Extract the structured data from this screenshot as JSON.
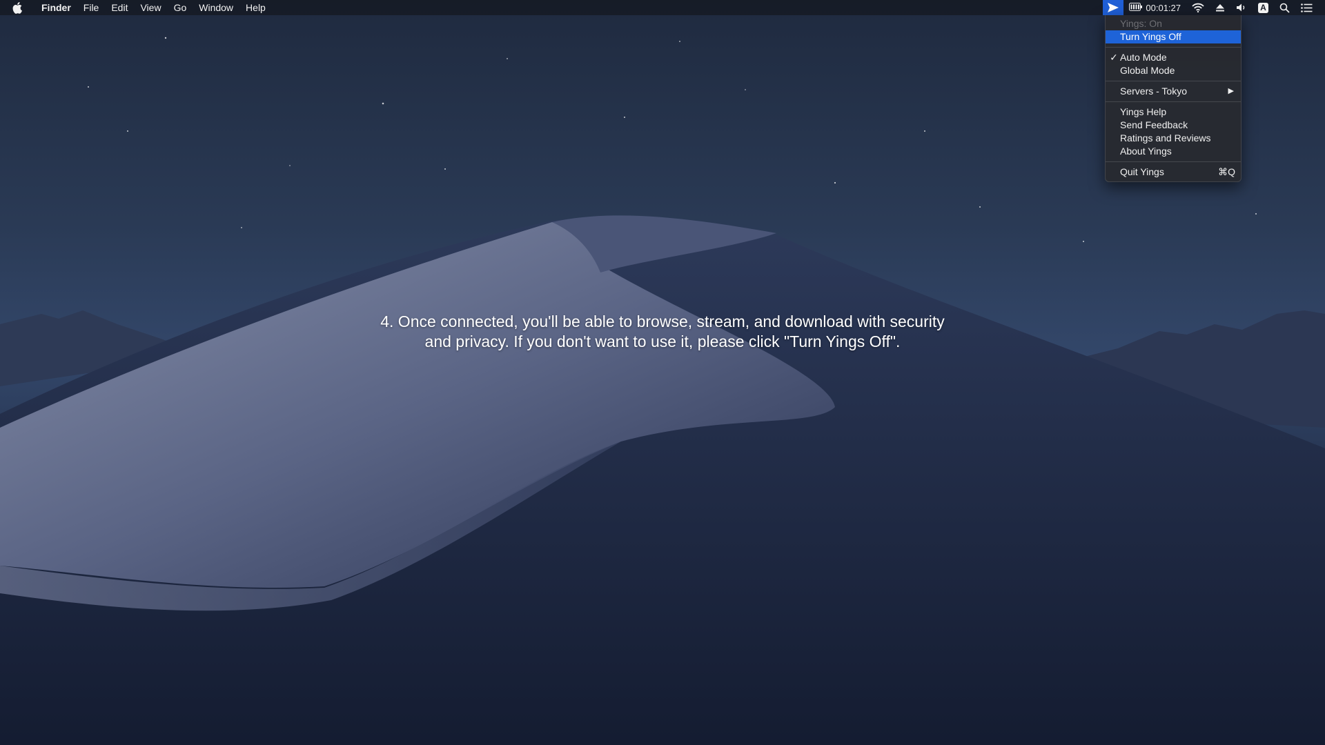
{
  "menubar": {
    "app_name": "Finder",
    "menus": [
      "File",
      "Edit",
      "View",
      "Go",
      "Window",
      "Help"
    ],
    "status": {
      "timer": "00:01:27",
      "input_source": "A"
    }
  },
  "dropdown": {
    "status_label": "Yings: On",
    "toggle_label": "Turn Yings Off",
    "auto_mode": "Auto Mode",
    "global_mode": "Global Mode",
    "servers": "Servers - Tokyo",
    "help": "Yings Help",
    "feedback": "Send Feedback",
    "ratings": "Ratings and Reviews",
    "about": "About Yings",
    "quit": "Quit Yings",
    "quit_shortcut": "⌘Q",
    "checkmark": "✓",
    "submenu_arrow": "▶"
  },
  "caption": {
    "line1": "4. Once connected, you'll be able to browse, stream, and download with security",
    "line2": "and privacy. If you don't want to use it, please click \"Turn Yings Off\"."
  },
  "colors": {
    "highlight": "#1e63d8",
    "active_status": "#1f5fd6"
  }
}
